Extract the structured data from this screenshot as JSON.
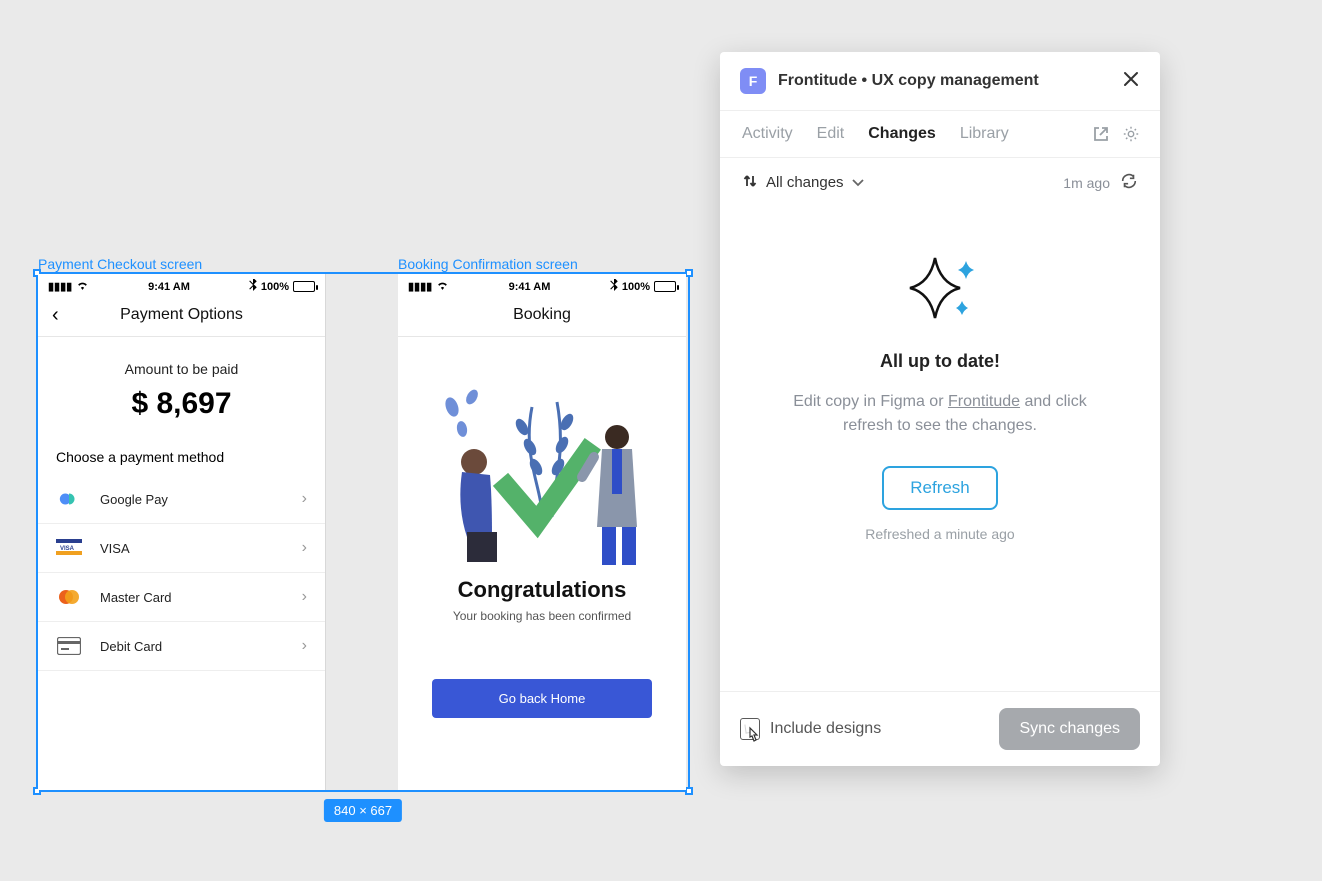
{
  "canvas": {
    "frame1_label": "Payment Checkout screen",
    "frame2_label": "Booking Confirmation screen",
    "selection_dimensions": "840 × 667"
  },
  "statusbar": {
    "time": "9:41 AM",
    "battery_pct": "100%"
  },
  "payment": {
    "navbar_title": "Payment Options",
    "amount_label": "Amount to be paid",
    "amount_value": "$ 8,697",
    "section_label": "Choose a payment method",
    "methods": [
      {
        "name": "Google Pay"
      },
      {
        "name": "VISA"
      },
      {
        "name": "Master Card"
      },
      {
        "name": "Debit Card"
      }
    ]
  },
  "booking": {
    "navbar_title": "Booking",
    "headline": "Congratulations",
    "subline": "Your booking has been confirmed",
    "cta": "Go back Home"
  },
  "plugin": {
    "title": "Frontitude • UX copy management",
    "logo_letter": "F",
    "tabs": {
      "activity": "Activity",
      "edit": "Edit",
      "changes": "Changes",
      "library": "Library"
    },
    "filter_label": "All changes",
    "last_sync": "1m ago",
    "empty_heading": "All up to date!",
    "empty_body_pre": "Edit copy in Figma or ",
    "empty_body_link": "Frontitude",
    "empty_body_post": " and click refresh to see the changes.",
    "refresh_label": "Refresh",
    "refreshed_ago": "Refreshed a minute ago",
    "include_designs_label": "Include designs",
    "sync_label": "Sync changes"
  }
}
